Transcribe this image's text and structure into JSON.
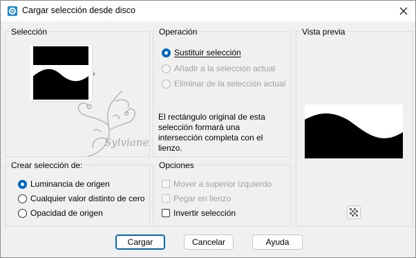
{
  "window": {
    "title": "Cargar selección desde disco",
    "icon": "app-logo-icon",
    "close_icon": "close-icon"
  },
  "seleccion": {
    "title": "Selección",
    "watermark": "Sylviane"
  },
  "operacion": {
    "title": "Operación",
    "options": [
      {
        "label": "Sustituir selección",
        "checked": true,
        "enabled": true
      },
      {
        "label": "Añadir a la selección actual",
        "checked": false,
        "enabled": false
      },
      {
        "label": "Eliminar de la selección actual",
        "checked": false,
        "enabled": false
      }
    ],
    "info": "El rectángulo original de esta selección formará una intersección completa con el lienzo."
  },
  "vista_previa": {
    "title": "Vista previa",
    "checker_icon": "transparency-checker-icon"
  },
  "crear": {
    "title": "Crear selección de:",
    "options": [
      {
        "label": "Luminancia de origen",
        "checked": true
      },
      {
        "label": "Cualquier valor distinto de cero",
        "checked": false
      },
      {
        "label": "Opacidad de origen",
        "checked": false
      }
    ]
  },
  "opciones": {
    "title": "Opciones",
    "items": [
      {
        "label": "Mover a superior izquierdo",
        "checked": false,
        "enabled": false
      },
      {
        "label": "Pegar en lienzo",
        "checked": false,
        "enabled": false
      },
      {
        "label": "Invertir selección",
        "checked": false,
        "enabled": true
      }
    ]
  },
  "buttons": {
    "ok": "Cargar",
    "cancel": "Cancelar",
    "help": "Ayuda"
  },
  "colors": {
    "accent": "#0067c0",
    "background": "#f0f0f0"
  }
}
